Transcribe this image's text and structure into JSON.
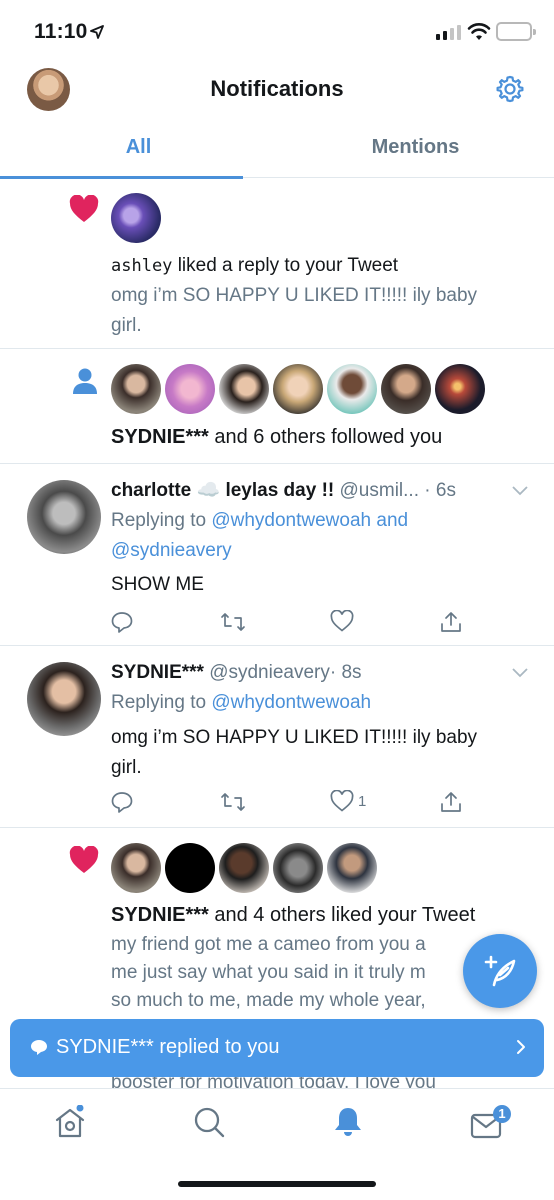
{
  "status_bar": {
    "time": "11:10"
  },
  "header": {
    "title": "Notifications"
  },
  "tabs": [
    {
      "label": "All",
      "active": true
    },
    {
      "label": "Mentions",
      "active": false
    }
  ],
  "notifications": {
    "like1": {
      "user": "ashley",
      "action": "liked a reply to your Tweet",
      "preview_line1": "omg i’m SO HAPPY U LIKED IT!!!!! ily baby",
      "preview_line2": "girl."
    },
    "follow1": {
      "text_user": "SYDNIE***",
      "text_rest": "and 6 others followed you"
    },
    "tweet1": {
      "name": "charlotte ☁️ leylas day !!",
      "handle": "@usmil...",
      "time": "· 6s",
      "replying_prefix": "Replying to",
      "replying_line1": "@whydontwewoah and",
      "replying_line2": "@sydnieavery",
      "body": "SHOW ME",
      "likes": ""
    },
    "tweet2": {
      "name": "SYDNIE***",
      "handle": "@sydnieavery",
      "time": "· 8s",
      "replying_prefix": "Replying to",
      "replying_line1": "@whydontwewoah",
      "body_line1": "omg i’m SO HAPPY U LIKED IT!!!!! ily baby",
      "body_line2": "girl.",
      "likes": "1"
    },
    "like2": {
      "text_user": "SYDNIE***",
      "text_rest": "and 4 others liked your Tweet",
      "preview_line1": "my friend got me a cameo from you a",
      "preview_line2": "me just say what you said in it truly m",
      "preview_line3": "so much to me, made my whole year,",
      "preview_line4": "booster for motivation today. I love you"
    }
  },
  "banner": {
    "text": "SYDNIE*** replied to you"
  },
  "bottom_nav": {
    "messages_badge": "1"
  },
  "colors": {
    "accent": "#4a90d9",
    "like": "#e0245e",
    "muted": "#657786"
  }
}
